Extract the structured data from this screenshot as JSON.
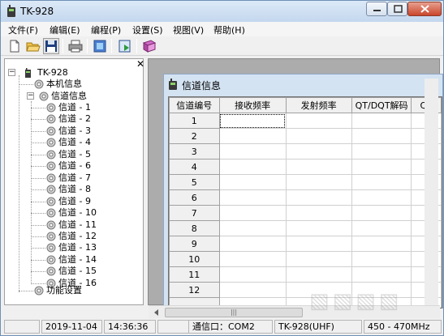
{
  "window": {
    "title": "TK-928"
  },
  "menu": [
    "文件(F)",
    "编辑(E)",
    "编程(P)",
    "设置(S)",
    "视图(V)",
    "帮助(H)"
  ],
  "toolbar": {
    "icons": [
      "new-file-icon",
      "open-folder-icon",
      "save-icon",
      "print-icon",
      "read-radio-icon",
      "write-radio-icon",
      "help-book-icon"
    ]
  },
  "tree": {
    "root": "TK-928",
    "local_info": "本机信息",
    "channel_info": "信道信息",
    "channels": [
      "信道 - 1",
      "信道 - 2",
      "信道 - 3",
      "信道 - 4",
      "信道 - 5",
      "信道 - 6",
      "信道 - 7",
      "信道 - 8",
      "信道 - 9",
      "信道 - 10",
      "信道 - 11",
      "信道 - 12",
      "信道 - 13",
      "信道 - 14",
      "信道 - 15",
      "信道 - 16"
    ],
    "function_settings": "功能设置"
  },
  "child_window": {
    "title": "信道信息"
  },
  "grid": {
    "columns": [
      "信道编号",
      "接收频率",
      "发射频率",
      "QT/DQT解码",
      "QT"
    ],
    "rows": [
      "1",
      "2",
      "3",
      "4",
      "5",
      "6",
      "7",
      "8",
      "9",
      "10",
      "11",
      "12",
      ""
    ]
  },
  "statusbar": {
    "date": "2019-11-04",
    "time": "14:36:36",
    "port": "通信口：COM2",
    "model": "TK-928(UHF)",
    "band": "450 - 470MHz"
  }
}
